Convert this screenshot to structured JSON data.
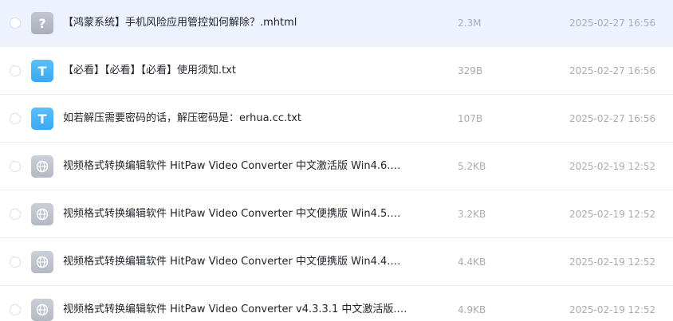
{
  "files": [
    {
      "name": "【鸿蒙系统】手机风险应用管控如何解除？.mhtml",
      "size": "2.3M",
      "date": "2025-02-27 16:56",
      "icon": "unknown-file-icon",
      "selected": true
    },
    {
      "name": "【必看】【必看】【必看】使用须知.txt",
      "size": "329B",
      "date": "2025-02-27 16:56",
      "icon": "txt-file-icon",
      "selected": false
    },
    {
      "name": "如若解压需要密码的话，解压密码是：erhua.cc.txt",
      "size": "107B",
      "date": "2025-02-27 16:56",
      "icon": "txt-file-icon",
      "selected": false
    },
    {
      "name": "视频格式转换编辑软件 HitPaw Video Converter 中文激活版 Win4.6.…",
      "size": "5.2KB",
      "date": "2025-02-19 12:52",
      "icon": "web-link-icon",
      "selected": false
    },
    {
      "name": "视频格式转换编辑软件 HitPaw Video Converter 中文便携版 Win4.5.…",
      "size": "3.2KB",
      "date": "2025-02-19 12:52",
      "icon": "web-link-icon",
      "selected": false
    },
    {
      "name": "视频格式转换编辑软件 HitPaw Video Converter 中文便携版 Win4.4.…",
      "size": "4.4KB",
      "date": "2025-02-19 12:52",
      "icon": "web-link-icon",
      "selected": false
    },
    {
      "name": "视频格式转换编辑软件 HitPaw Video Converter v4.3.3.1 中文激活版.…",
      "size": "4.9KB",
      "date": "2025-02-19 12:52",
      "icon": "web-link-icon",
      "selected": false
    }
  ]
}
